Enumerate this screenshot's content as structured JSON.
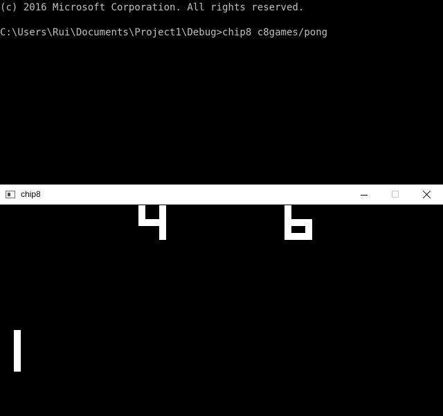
{
  "console": {
    "copyright_line": "(c) 2016 Microsoft Corporation. All rights reserved.",
    "prompt_line": "C:\\Users\\Rui\\Documents\\Project1\\Debug>chip8 c8games/pong"
  },
  "window": {
    "title": "chip8",
    "app_icon": "application-window-icon",
    "minimize_icon": "minimize-icon",
    "maximize_icon": "maximize-icon",
    "close_icon": "close-icon"
  },
  "game": {
    "left_score": "4",
    "right_score": "6",
    "pixel_color": "#ffffff",
    "background_color": "#000000"
  }
}
